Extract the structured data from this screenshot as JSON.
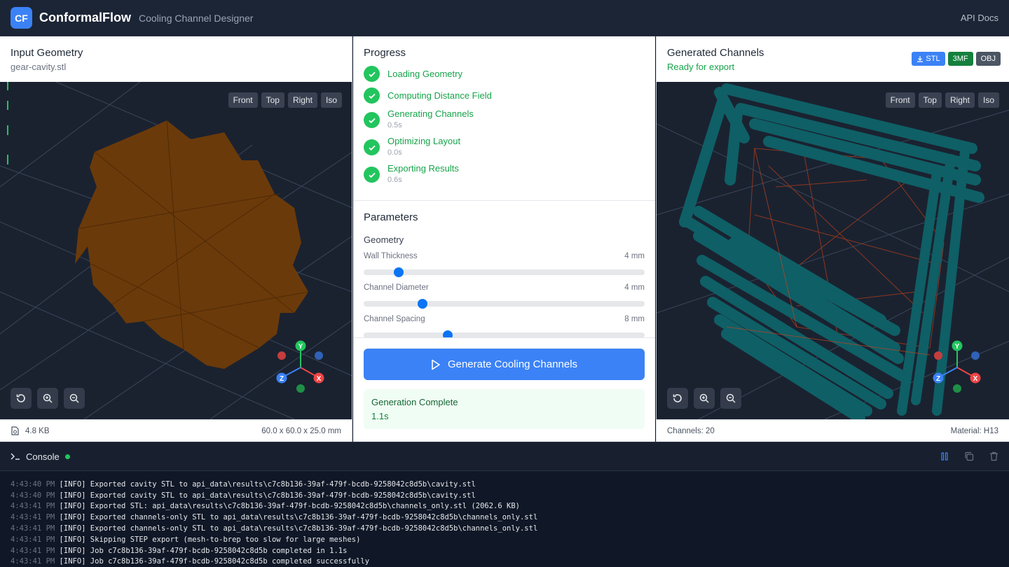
{
  "header": {
    "logo": "CF",
    "app_name": "ConformalFlow",
    "subtitle": "Cooling Channel Designer",
    "api_docs": "API Docs"
  },
  "input_panel": {
    "title": "Input Geometry",
    "filename": "gear-cavity.stl",
    "view_buttons": [
      "Front",
      "Top",
      "Right",
      "Iso"
    ],
    "file_size": "4.8 KB",
    "dimensions": "60.0 x 60.0 x 25.0 mm",
    "mesh_color": "#6b3a0a"
  },
  "progress": {
    "title": "Progress",
    "steps": [
      {
        "label": "Loading Geometry",
        "time": ""
      },
      {
        "label": "Computing Distance Field",
        "time": ""
      },
      {
        "label": "Generating Channels",
        "time": "0.5s"
      },
      {
        "label": "Optimizing Layout",
        "time": "0.0s"
      },
      {
        "label": "Exporting Results",
        "time": "0.6s"
      }
    ]
  },
  "parameters": {
    "title": "Parameters",
    "group": "Geometry",
    "items": [
      {
        "label": "Wall Thickness",
        "value": "4 mm",
        "level": 0.125
      },
      {
        "label": "Channel Diameter",
        "value": "4 mm",
        "level": 0.21
      },
      {
        "label": "Channel Spacing",
        "value": "8 mm",
        "level": 0.3
      }
    ]
  },
  "generate": {
    "button": "Generate Cooling Channels",
    "status_title": "Generation Complete",
    "status_time": "1.1s"
  },
  "output_panel": {
    "title": "Generated Channels",
    "status": "Ready for export",
    "export_buttons": [
      "STL",
      "3MF",
      "OBJ"
    ],
    "view_buttons": [
      "Front",
      "Top",
      "Right",
      "Iso"
    ],
    "channels": "Channels: 20",
    "material": "Material: H13",
    "channel_color": "#0f5f66"
  },
  "console": {
    "title": "Console",
    "lines": [
      {
        "ts": "4:43:40 PM",
        "msg": "[INFO] Exported cavity STL to api_data\\results\\c7c8b136-39af-479f-bcdb-9258042c8d5b\\cavity.stl"
      },
      {
        "ts": "4:43:40 PM",
        "msg": "[INFO] Exported cavity STL to api_data\\results\\c7c8b136-39af-479f-bcdb-9258042c8d5b\\cavity.stl"
      },
      {
        "ts": "4:43:41 PM",
        "msg": "[INFO] Exported STL: api_data\\results\\c7c8b136-39af-479f-bcdb-9258042c8d5b\\channels_only.stl (2062.6 KB)"
      },
      {
        "ts": "4:43:41 PM",
        "msg": "[INFO] Exported channels-only STL to api_data\\results\\c7c8b136-39af-479f-bcdb-9258042c8d5b\\channels_only.stl"
      },
      {
        "ts": "4:43:41 PM",
        "msg": "[INFO] Exported channels-only STL to api_data\\results\\c7c8b136-39af-479f-bcdb-9258042c8d5b\\channels_only.stl"
      },
      {
        "ts": "4:43:41 PM",
        "msg": "[INFO] Skipping STEP export (mesh-to-brep too slow for large meshes)"
      },
      {
        "ts": "4:43:41 PM",
        "msg": "[INFO] Job c7c8b136-39af-479f-bcdb-9258042c8d5b completed in 1.1s"
      },
      {
        "ts": "4:43:41 PM",
        "msg": "[INFO] Job c7c8b136-39af-479f-bcdb-9258042c8d5b completed successfully"
      }
    ]
  },
  "gizmo": {
    "x": "X",
    "y": "Y",
    "z": "Z"
  }
}
